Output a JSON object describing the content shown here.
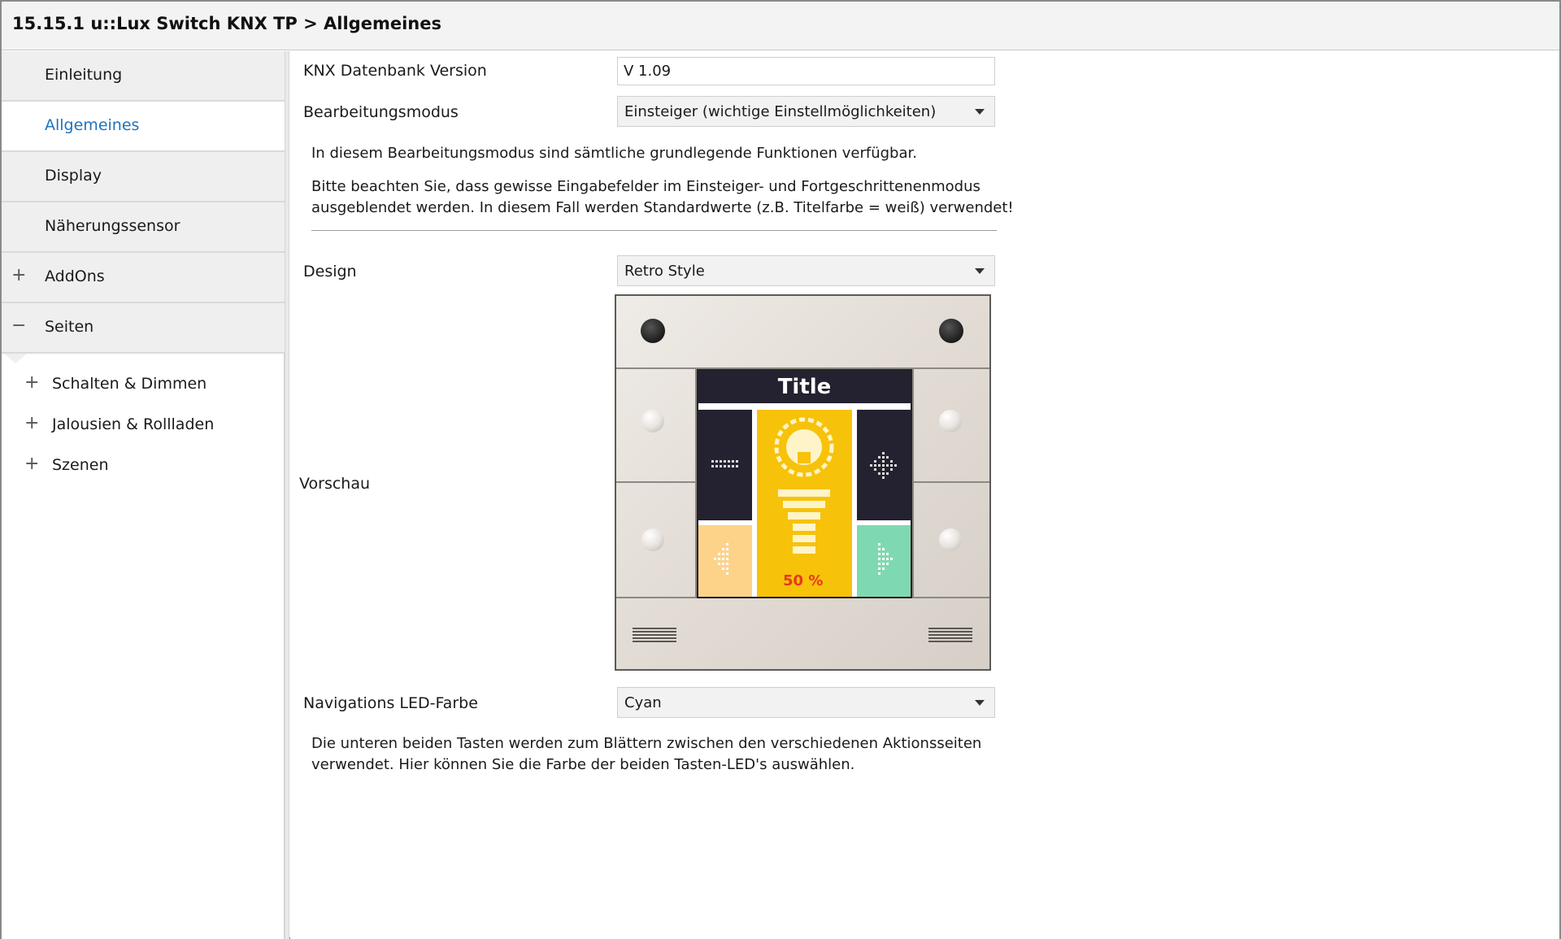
{
  "window": {
    "title": "15.15.1 u::Lux Switch KNX TP > Allgemeines"
  },
  "sidebar": {
    "items": [
      {
        "label": "Einleitung",
        "expander": ""
      },
      {
        "label": "Allgemeines",
        "expander": ""
      },
      {
        "label": "Display",
        "expander": ""
      },
      {
        "label": "Näherungssensor",
        "expander": ""
      },
      {
        "label": "AddOns",
        "expander": "+"
      },
      {
        "label": "Seiten",
        "expander": "−"
      }
    ],
    "sub_items": [
      {
        "label": "Schalten & Dimmen",
        "expander": "+"
      },
      {
        "label": "Jalousien & Rollladen",
        "expander": "+"
      },
      {
        "label": "Szenen",
        "expander": "+"
      }
    ]
  },
  "form": {
    "db_version": {
      "label": "KNX Datenbank Version",
      "value": "V 1.09"
    },
    "edit_mode": {
      "label": "Bearbeitungsmodus",
      "value": "Einsteiger (wichtige Einstellmöglichkeiten)"
    },
    "edit_mode_info": "In diesem Bearbeitungsmodus sind sämtliche grundlegende Funktionen verfügbar.",
    "edit_mode_note_1": "Bitte beachten Sie, dass gewisse Eingabefelder im Einsteiger- und Fortgeschrittenenmodus",
    "edit_mode_note_2": "ausgeblendet werden. In diesem Fall werden Standardwerte (z.B. Titelfarbe = weiß) verwendet!",
    "design": {
      "label": "Design",
      "value": "Retro Style"
    },
    "preview": {
      "label": "Vorschau",
      "screen_title": "Title",
      "percent": "50 %"
    },
    "nav_led": {
      "label": "Navigations LED-Farbe",
      "value": "Cyan"
    },
    "nav_led_info_1": "Die unteren beiden Tasten werden zum Blättern zwischen den verschiedenen Aktionsseiten",
    "nav_led_info_2": "verwendet. Hier können Sie die Farbe der beiden Tasten-LED's auswählen."
  },
  "colors": {
    "accent": "#1e73be",
    "screen_dark": "#242230",
    "tile_yellow": "#f7c20a",
    "tile_peach": "#fdd38a",
    "tile_mint": "#7fd9b0",
    "percent_red": "#e53a1a"
  },
  "icons": {
    "nav_prev": "dotted-left-arrow-icon",
    "nav_next": "dotted-right-arrow-icon",
    "bulb": "light-bulb-icon",
    "blinds": "blinds-icon",
    "move": "dotted-move-arrows-icon"
  }
}
